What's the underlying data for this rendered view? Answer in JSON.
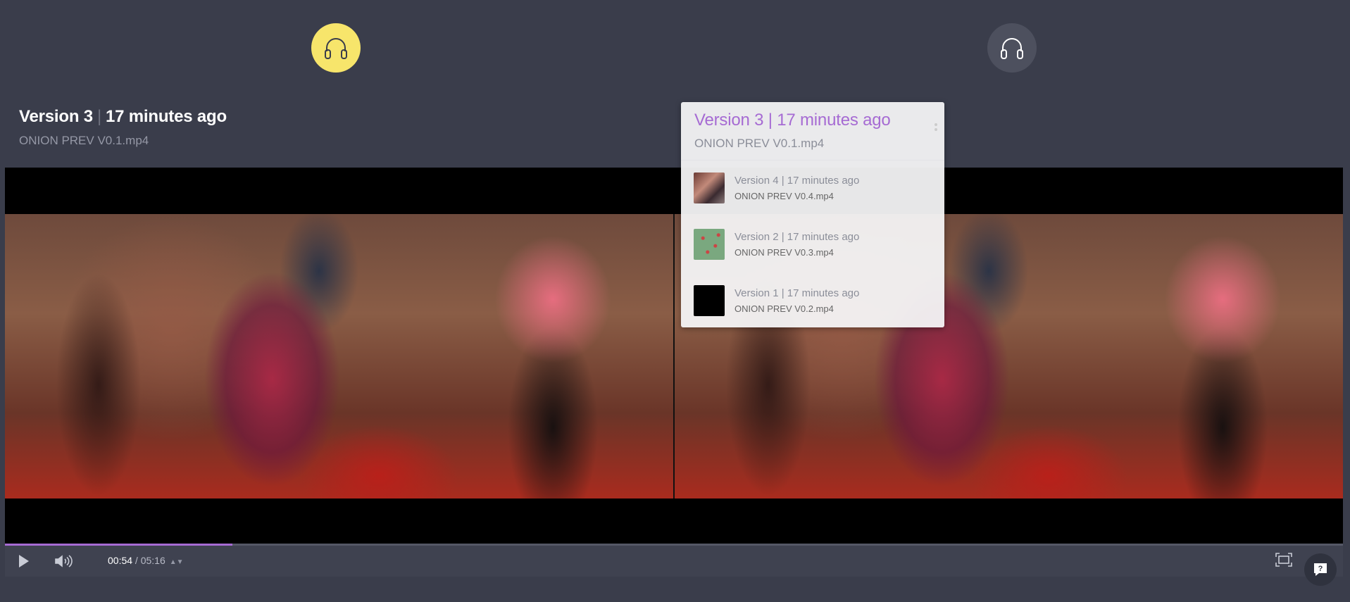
{
  "audio": {
    "left_icon": "headphones-icon",
    "right_icon": "headphones-icon"
  },
  "left_panel": {
    "version": "Version 3",
    "separator": "|",
    "time_ago": "17 minutes ago",
    "filename": "ONION PREV V0.1.mp4"
  },
  "dropdown": {
    "title": "Version 3 | 17 minutes ago",
    "filename": "ONION PREV V0.1.mp4",
    "items": [
      {
        "title": "Version 4 | 17 minutes ago",
        "file": "ONION PREV V0.4.mp4"
      },
      {
        "title": "Version 2 | 17 minutes ago",
        "file": "ONION PREV V0.3.mp4"
      },
      {
        "title": "Version 1 | 17 minutes ago",
        "file": "ONION PREV V0.2.mp4"
      }
    ]
  },
  "player": {
    "current_time": "00:54",
    "time_separator": " / ",
    "duration": "05:16",
    "progress_fraction": 0.17
  },
  "colors": {
    "accent": "#a66bd3",
    "audio_active": "#f7e56b",
    "background": "#3a3d4b"
  }
}
